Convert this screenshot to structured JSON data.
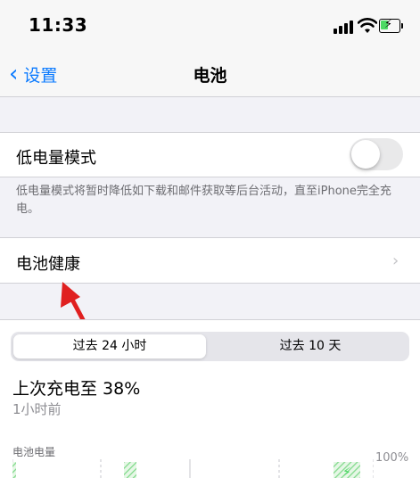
{
  "status_bar": {
    "time": "11:33"
  },
  "nav": {
    "back_label": "设置",
    "title": "电池"
  },
  "low_power": {
    "label": "低电量模式",
    "enabled": false,
    "footnote": "低电量模式将暂时降低如下载和邮件获取等后台活动，直至iPhone完全充电。"
  },
  "battery_health": {
    "label": "电池健康"
  },
  "range_tabs": {
    "tabs": [
      "过去 24 小时",
      "过去 10 天"
    ],
    "selected": "过去 24 小时"
  },
  "last_charge": {
    "text": "上次充电至 38%",
    "time": "1小时前"
  },
  "chart": {
    "title": "电池电量",
    "max_label": "100%"
  },
  "colors": {
    "accent": "#0a7aff",
    "charge_green": "#4cd964",
    "annotation_red": "#e02020"
  },
  "icons": [
    "chevron-left-icon",
    "chevron-right-icon",
    "cellular-signal-icon",
    "wifi-icon",
    "battery-charging-icon",
    "red-annotation-arrow"
  ]
}
